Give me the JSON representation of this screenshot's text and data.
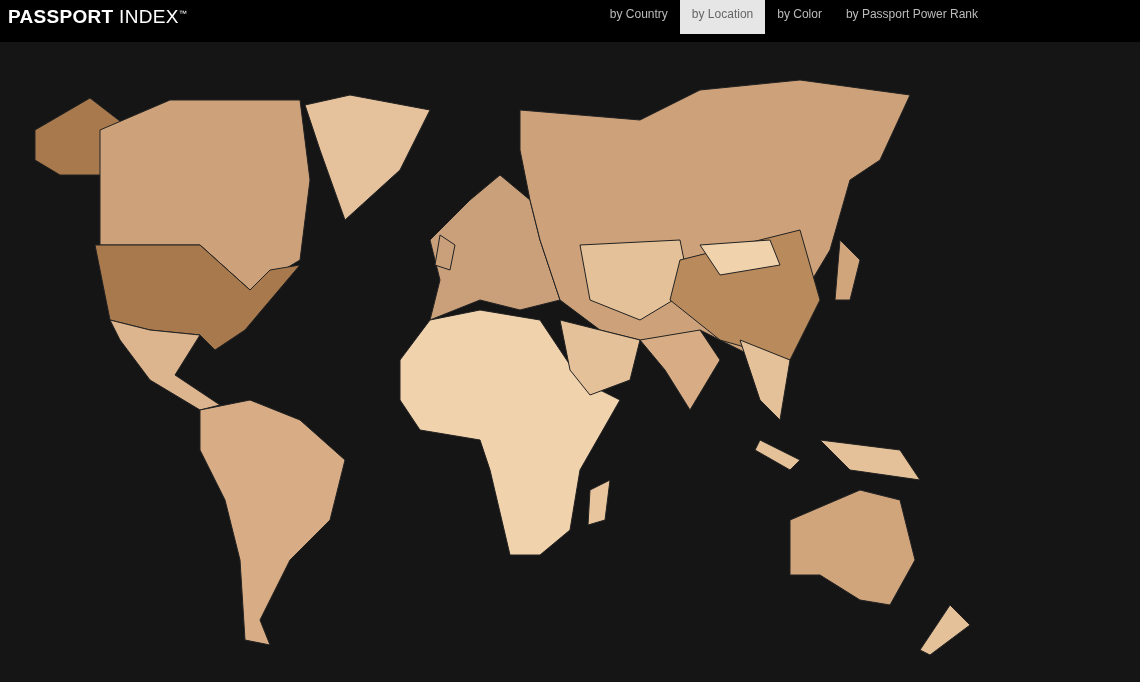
{
  "header": {
    "logo": "**PASSPORT** INDEX$^{™}$",
    "tabs": [
      {
        "label": "by Country",
        "selected": false
      },
      {
        "label": "by Location",
        "selected": true
      },
      {
        "label": "by Color",
        "selected": false
      },
      {
        "label": "by Passport Power Rank",
        "selected": false
      }
    ]
  }
}
